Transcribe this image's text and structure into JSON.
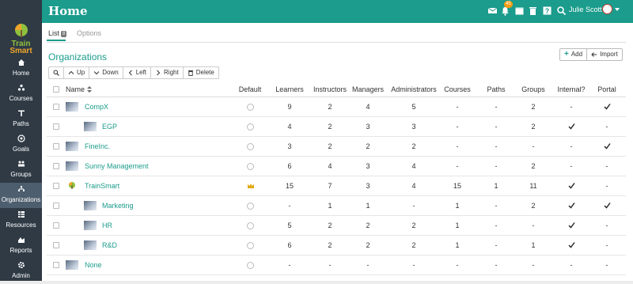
{
  "app": {
    "title": "Home"
  },
  "user": {
    "name": "Julie Scott"
  },
  "notifications": {
    "count": "45"
  },
  "logo": {
    "line1": "Train",
    "line2": "Smart"
  },
  "sidebar": {
    "items": [
      {
        "label": "Home",
        "icon": "home-icon"
      },
      {
        "label": "Courses",
        "icon": "courses-icon"
      },
      {
        "label": "Paths",
        "icon": "paths-icon"
      },
      {
        "label": "Goals",
        "icon": "goals-icon"
      },
      {
        "label": "Groups",
        "icon": "groups-icon"
      },
      {
        "label": "Organizations",
        "icon": "organizations-icon",
        "active": true
      },
      {
        "label": "Resources",
        "icon": "resources-icon"
      },
      {
        "label": "Reports",
        "icon": "reports-icon"
      },
      {
        "label": "Admin",
        "icon": "admin-icon"
      }
    ]
  },
  "tabs": {
    "list_label": "List",
    "list_count": "8",
    "options_label": "Options"
  },
  "header_buttons": {
    "add": "Add",
    "import": "Import"
  },
  "section": {
    "title": "Organizations"
  },
  "toolbar": {
    "up": "Up",
    "down": "Down",
    "left": "Left",
    "right": "Right",
    "delete": "Delete"
  },
  "table": {
    "columns": {
      "name": "Name",
      "default": "Default",
      "learners": "Learners",
      "instructors": "Instructors",
      "managers": "Managers",
      "administrators": "Administrators",
      "courses": "Courses",
      "paths": "Paths",
      "groups": "Groups",
      "internal": "Internal?",
      "portal": "Portal"
    },
    "rows": [
      {
        "name": "CompX",
        "indent": 0,
        "default": "radio",
        "learners": "9",
        "instructors": "2",
        "managers": "4",
        "administrators": "5",
        "courses": "-",
        "paths": "-",
        "groups": "2",
        "internal": "-",
        "portal": "check"
      },
      {
        "name": "EGP",
        "indent": 1,
        "default": "radio",
        "learners": "4",
        "instructors": "2",
        "managers": "3",
        "administrators": "3",
        "courses": "-",
        "paths": "-",
        "groups": "2",
        "internal": "check",
        "portal": "-"
      },
      {
        "name": "FineInc.",
        "indent": 0,
        "default": "radio",
        "learners": "3",
        "instructors": "2",
        "managers": "2",
        "administrators": "2",
        "courses": "-",
        "paths": "-",
        "groups": "-",
        "internal": "-",
        "portal": "check"
      },
      {
        "name": "Sunny Management",
        "indent": 0,
        "default": "radio",
        "learners": "6",
        "instructors": "4",
        "managers": "3",
        "administrators": "4",
        "courses": "-",
        "paths": "-",
        "groups": "2",
        "internal": "-",
        "portal": "-"
      },
      {
        "name": "TrainSmart",
        "indent": 0,
        "default": "crown",
        "learners": "15",
        "instructors": "7",
        "managers": "3",
        "administrators": "4",
        "courses": "15",
        "paths": "1",
        "groups": "11",
        "internal": "check",
        "portal": "-"
      },
      {
        "name": "Marketing",
        "indent": 1,
        "default": "radio",
        "learners": "-",
        "instructors": "1",
        "managers": "1",
        "administrators": "-",
        "courses": "1",
        "paths": "-",
        "groups": "2",
        "internal": "check",
        "portal": "check"
      },
      {
        "name": "HR",
        "indent": 1,
        "default": "radio",
        "learners": "5",
        "instructors": "2",
        "managers": "2",
        "administrators": "2",
        "courses": "1",
        "paths": "-",
        "groups": "-",
        "internal": "check",
        "portal": "-"
      },
      {
        "name": "R&D",
        "indent": 1,
        "default": "radio",
        "learners": "6",
        "instructors": "2",
        "managers": "2",
        "administrators": "2",
        "courses": "1",
        "paths": "-",
        "groups": "1",
        "internal": "check",
        "portal": "-"
      },
      {
        "name": "None",
        "indent": 0,
        "default": "radio",
        "learners": "-",
        "instructors": "-",
        "managers": "-",
        "administrators": "-",
        "courses": "-",
        "paths": "-",
        "groups": "-",
        "internal": "-",
        "portal": "-"
      }
    ]
  },
  "colors": {
    "accent": "#1b9c8c",
    "sidebar": "#2f3a45",
    "sidebar_active": "#4d5e6e"
  }
}
